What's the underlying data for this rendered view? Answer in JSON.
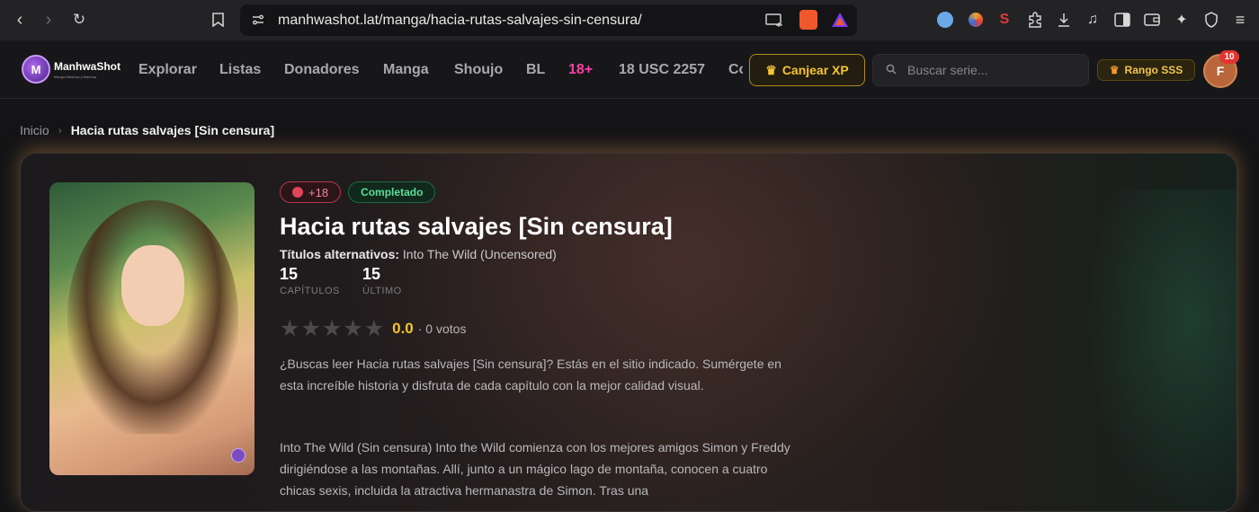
{
  "browser": {
    "url": "manhwashot.lat/manga/hacia-rutas-salvajes-sin-censura/"
  },
  "header": {
    "logo_title": "ManhwaShot",
    "logo_subtitle": "Manga Manhwa y Manhua",
    "menu": [
      "Explorar",
      "Listas",
      "Donadores",
      "Manga",
      "Shoujo",
      "BL",
      "18+",
      "18 USC 2257",
      "Co"
    ],
    "xp_button": "Canjear XP",
    "search_placeholder": "Buscar serie...",
    "rank": "Rango SSS",
    "avatar_initial": "F",
    "notifications": "10"
  },
  "breadcrumb": {
    "home": "Inicio",
    "separator": "›",
    "current": "Hacia rutas salvajes [Sin censura]"
  },
  "series": {
    "adult_badge": "+18",
    "status_badge": "Completado",
    "title": "Hacia rutas salvajes [Sin censura]",
    "alt_label": "Títulos alternativos:",
    "alt_value": "Into The Wild (Uncensored)",
    "chapters_value": "15",
    "chapters_label": "CAPÍTULOS",
    "last_value": "15",
    "last_label": "ÚLTIMO",
    "rating_score": "0.0",
    "rating_votes": "· 0 votos",
    "rating_stars": 0,
    "description_1": "¿Buscas leer Hacia rutas salvajes [Sin censura]? Estás en el sitio indicado. Sumérgete en esta increíble historia y disfruta de cada capítulo con la mejor calidad visual.",
    "description_2": "Into The Wild (Sin censura) Into the Wild comienza con los mejores amigos Simon y Freddy dirigiéndose a las montañas. Allí, junto a un mágico lago de montaña, conocen a cuatro chicas sexis, incluida la atractiva hermanastra de Simon. Tras una"
  },
  "colors": {
    "accent_gold": "#f6c531",
    "hot_pink": "#ff3ea5",
    "status_green": "#5fdc95"
  }
}
